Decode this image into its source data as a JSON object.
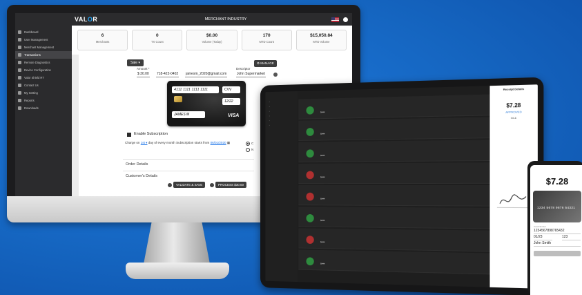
{
  "brand": {
    "logo_main": "VAL",
    "logo_accent": "O",
    "logo_end": "R"
  },
  "header": {
    "title": "MERCHANT INDUSTRY"
  },
  "sidebar": {
    "items": [
      {
        "label": "Dashboard"
      },
      {
        "label": "User Management"
      },
      {
        "label": "Merchant Management"
      },
      {
        "label": "Transactions"
      },
      {
        "label": "Remote Diagnostics"
      },
      {
        "label": "Device Configuration"
      },
      {
        "label": "Valor Shield RT"
      },
      {
        "label": "Contact Us"
      },
      {
        "label": "My Setting"
      },
      {
        "label": "Reports"
      },
      {
        "label": "Downloads"
      }
    ]
  },
  "stats": [
    {
      "value": "6",
      "label": "Merchants"
    },
    {
      "value": "0",
      "label": "TX Count"
    },
    {
      "value": "$0.00",
      "label": "Volume (Today)"
    },
    {
      "value": "170",
      "label": "MTD Count"
    },
    {
      "value": "$15,050.84",
      "label": "MTD Volume"
    }
  ],
  "form": {
    "sale_label": "Sale ▾",
    "manage_label": "⚙ MANAGE",
    "amount_label": "Amount *",
    "amount_value": "$ 30.00",
    "phone_value": "718-422-0402",
    "email_value": "jamesm_2020@gmail.com",
    "descriptor_label": "Descriptor",
    "descriptor_value": "John Supermarket"
  },
  "card": {
    "number": "4111 1111 1111 1111",
    "cvv": "CVV",
    "expiry": "12/22",
    "name": "JAMES M",
    "network": "VISA"
  },
  "subscription": {
    "label": "Enable Subscription",
    "charge_prefix": "Charge on",
    "charge_day": "1st ▾",
    "charge_mid": "day of every month  Subscription starts from",
    "start_date": "06/01/2020",
    "radio_a": "C",
    "radio_b": "N"
  },
  "sections": {
    "order": "Order Details",
    "customer": "Customer's Details"
  },
  "actions": {
    "validate": "VALIDATE & SAVE",
    "process": "PROCESS $30.00"
  },
  "tablet": {
    "receipt_title": "Receipt Details",
    "amount": "$7.28",
    "status": "APPROVED",
    "type": "SALE",
    "rows": [
      {
        "status": "ok",
        "amount": "$###"
      },
      {
        "status": "ok",
        "amount": "$###"
      },
      {
        "status": "ok",
        "amount": "$###"
      },
      {
        "status": "bad",
        "amount": "$###"
      },
      {
        "status": "bad",
        "amount": "$###"
      },
      {
        "status": "ok",
        "amount": "$###"
      },
      {
        "status": "bad",
        "amount": "$###"
      },
      {
        "status": "ok",
        "amount": "$###"
      }
    ]
  },
  "phone": {
    "amount": "$7.28",
    "card_number": "1234 5678 9876 54321",
    "card_label": "Card Number",
    "card_field": "1234567898765432",
    "exp_field": "01/23",
    "cvv_field": "123",
    "name_field": "John Smith"
  }
}
